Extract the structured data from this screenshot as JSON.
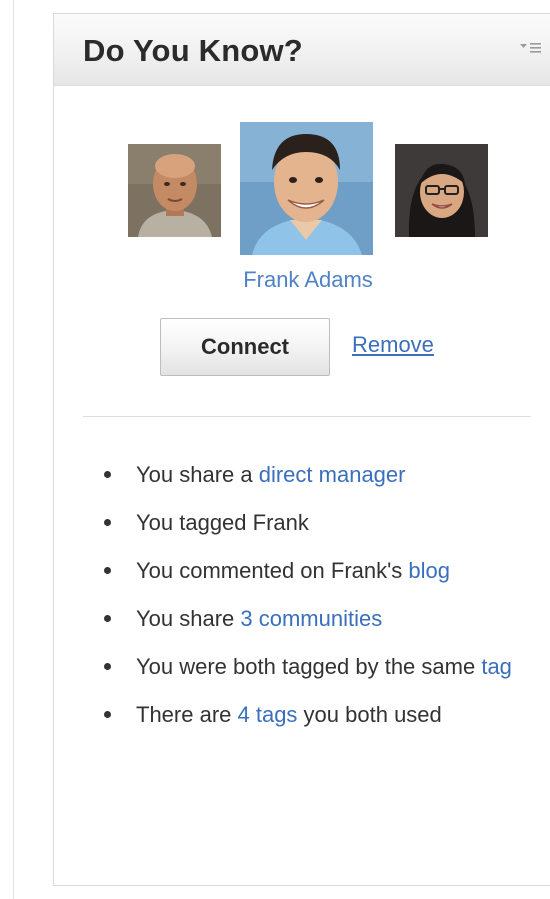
{
  "widget": {
    "title": "Do You Know?",
    "menu_icon": "sort-menu-icon"
  },
  "suggestion": {
    "name": "Frank Adams",
    "photos": [
      {
        "icon": "person-photo",
        "position": "left"
      },
      {
        "icon": "person-photo",
        "position": "center"
      },
      {
        "icon": "person-photo",
        "position": "right"
      }
    ],
    "connect_label": "Connect",
    "remove_label": "Remove"
  },
  "reasons": [
    {
      "text": "You share a ",
      "link": "direct manager",
      "suffix": ""
    },
    {
      "text": "You tagged Frank",
      "link": "",
      "suffix": ""
    },
    {
      "text": "You commented on Frank's ",
      "link": "blog",
      "suffix": ""
    },
    {
      "text": "You share ",
      "link": "3 communities",
      "suffix": ""
    },
    {
      "text": "You were both tagged by the same ",
      "link": "tag",
      "suffix": ""
    },
    {
      "text": "There are ",
      "link": "4 tags",
      "suffix": " you both used"
    }
  ],
  "colors": {
    "link": "#3a6fbd",
    "name": "#4f82c6",
    "text": "#333333"
  }
}
